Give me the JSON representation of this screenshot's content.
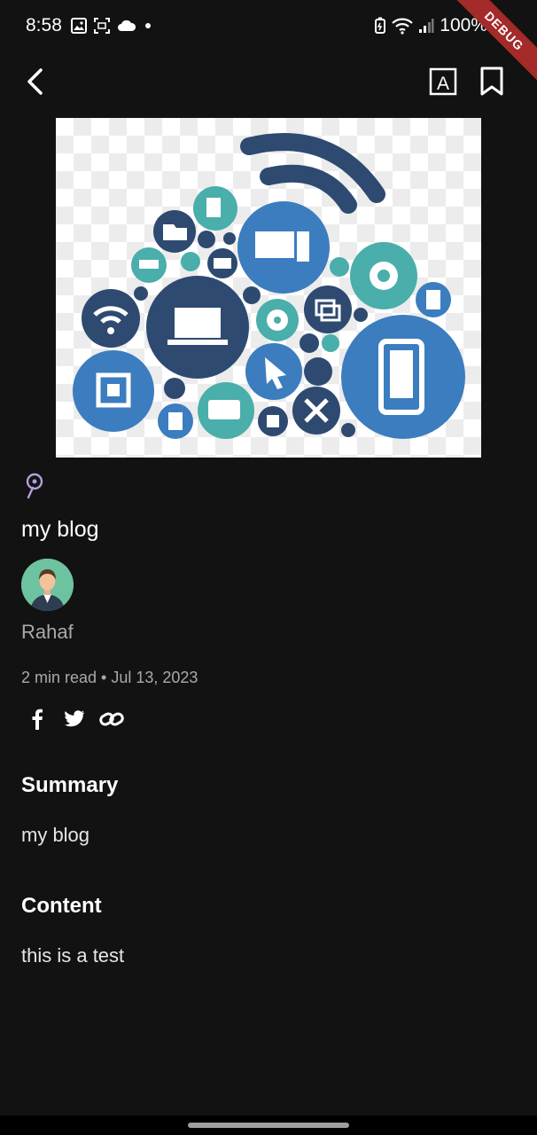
{
  "status_bar": {
    "time": "8:58",
    "battery_percent": "100%",
    "icons": [
      "gallery-icon",
      "screenshot-icon",
      "cloud-icon",
      "dot-icon",
      "battery-saver-icon",
      "wifi-icon",
      "signal-icon",
      "battery-icon"
    ]
  },
  "debug_banner": {
    "label": "DEBUG"
  },
  "app_bar": {
    "back_icon": "chevron-left-icon",
    "font_icon": "font-size-icon",
    "font_glyph": "A",
    "bookmark_icon": "bookmark-icon"
  },
  "post": {
    "category_icon": "podcast-icon",
    "title": "my blog",
    "author": "Rahaf",
    "read_time": "2 min read",
    "separator": "•",
    "date": "Jul 13, 2023",
    "share": [
      {
        "icon": "facebook-icon"
      },
      {
        "icon": "twitter-icon"
      },
      {
        "icon": "link-icon"
      }
    ],
    "summary_heading": "Summary",
    "summary_text": "my blog",
    "content_heading": "Content",
    "content_text": "this is a test"
  },
  "colors": {
    "background": "#121212",
    "accent_purple": "#b39ddb",
    "muted_text": "#a9a9a9",
    "debug_red": "#a52a2a",
    "image_dark_blue": "#2e4a70",
    "image_blue": "#3b7dbf",
    "image_teal": "#4aaeab"
  }
}
